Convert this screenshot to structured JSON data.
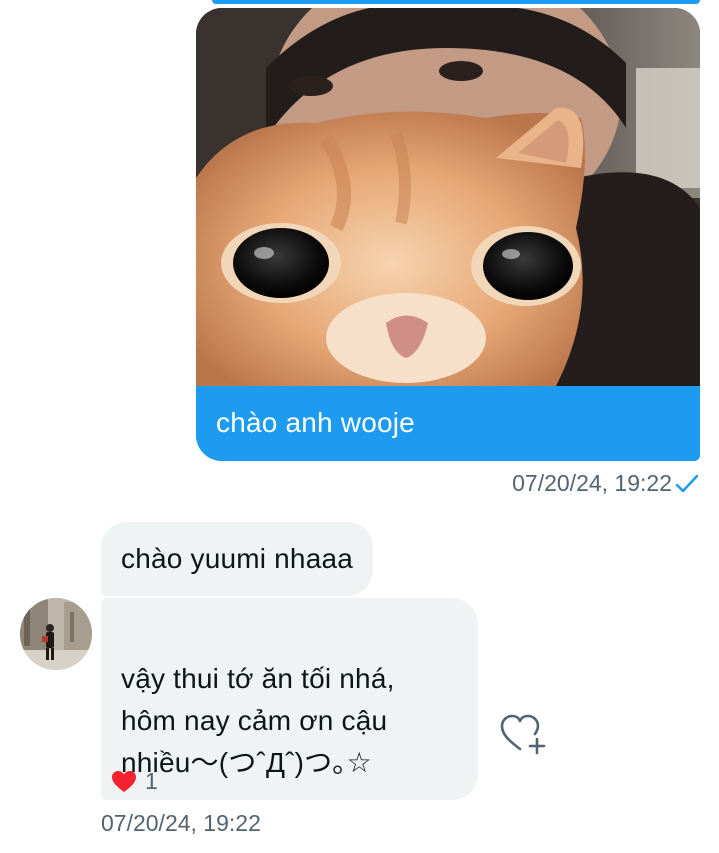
{
  "sent_message": {
    "image_alt": "selfie with orange cat",
    "text": "chào anh wooje",
    "timestamp": "07/20/24, 19:22",
    "status_icon": "check-icon"
  },
  "received_messages": [
    {
      "text": "chào yuumi nhaaa"
    },
    {
      "text": "vậy thui tớ ăn tối nhá,\nhôm nay cảm ơn cậu\nnhiều〜(つˆДˆ)つ｡☆"
    }
  ],
  "reaction": {
    "icon": "heart-icon",
    "count": "1"
  },
  "received_timestamp": "07/20/24, 19:22",
  "colors": {
    "accent": "#1d9bf0",
    "incoming_bubble": "#eff3f4",
    "meta_text": "#536471",
    "heart": "#f4212e"
  }
}
